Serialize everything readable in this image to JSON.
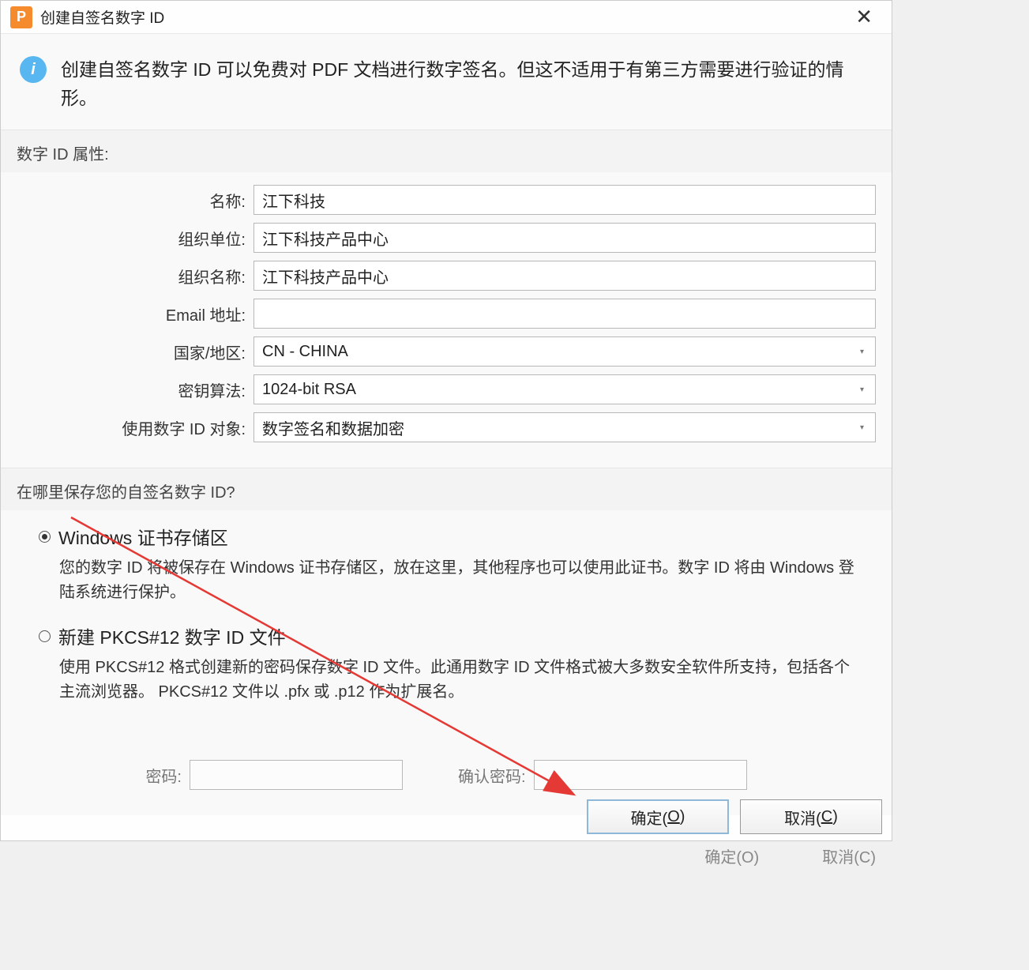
{
  "titlebar": {
    "app_letter": "P",
    "title": "创建自签名数字 ID",
    "close": "✕"
  },
  "info": {
    "icon": "i",
    "text": "创建自签名数字 ID 可以免费对 PDF 文档进行数字签名。但这不适用于有第三方需要进行验证的情形。"
  },
  "attrs": {
    "header": "数字 ID 属性:",
    "name_label": "名称:",
    "name_value": "江下科技",
    "org_unit_label": "组织单位:",
    "org_unit_value": "江下科技产品中心",
    "org_name_label": "组织名称:",
    "org_name_value": "江下科技产品中心",
    "email_label": "Email 地址:",
    "email_value": "",
    "country_label": "国家/地区:",
    "country_value": "CN - CHINA",
    "algo_label": "密钥算法:",
    "algo_value": "1024-bit RSA",
    "usage_label": "使用数字 ID 对象:",
    "usage_value": "数字签名和数据加密"
  },
  "store": {
    "header": "在哪里保存您的自签名数字 ID?",
    "opt1_title": "Windows 证书存储区",
    "opt1_desc": "您的数字 ID 将被保存在 Windows 证书存储区，放在这里，其他程序也可以使用此证书。数字 ID 将由 Windows 登陆系统进行保护。",
    "opt2_title": "新建 PKCS#12 数字 ID 文件",
    "opt2_desc": "使用 PKCS#12 格式创建新的密码保存数字 ID 文件。此通用数字 ID 文件格式被大多数安全软件所支持，包括各个主流浏览器。 PKCS#12 文件以 .pfx 或 .p12 作为扩展名。"
  },
  "pwd": {
    "label": "密码:",
    "confirm_label": "确认密码:"
  },
  "footer": {
    "ok_prefix": "确定(",
    "ok_key": "O",
    "ok_suffix": ")",
    "cancel_prefix": "取消(",
    "cancel_key": "C",
    "cancel_suffix": ")",
    "faded_ok": "确定(O)",
    "faded_cancel": "取消(C)"
  },
  "annotation": {
    "arrow_color": "#e53935"
  }
}
